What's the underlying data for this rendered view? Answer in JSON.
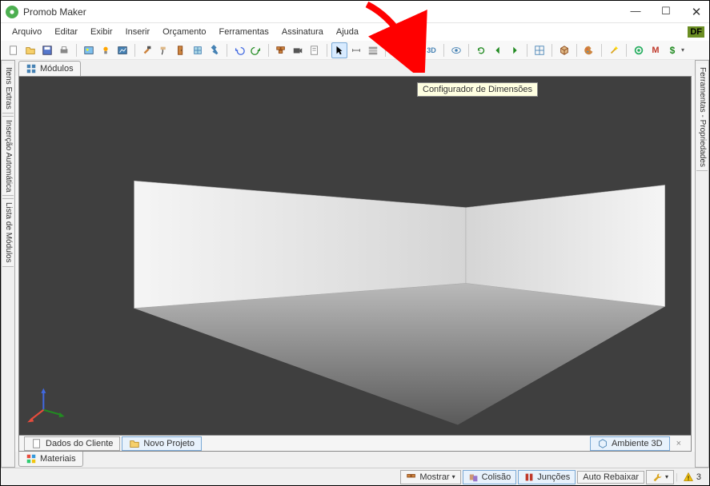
{
  "window": {
    "title": "Promob Maker"
  },
  "menus": [
    "Arquivo",
    "Editar",
    "Exibir",
    "Inserir",
    "Orçamento",
    "Ferramentas",
    "Assinatura",
    "Ajuda"
  ],
  "user_badge": "DF",
  "tooltip": "Configurador de Dimensões",
  "leftside": {
    "tab1": "Itens Extras",
    "tab2": "Inserção Automática",
    "tab3": "Lista de Módulos"
  },
  "rightside": {
    "tab1": "Ferramentas - Propriedades"
  },
  "top_tab": "Módulos",
  "bottom_tabs": {
    "dados": "Dados do Cliente",
    "novo": "Novo Projeto",
    "ambiente": "Ambiente 3D"
  },
  "bottom_tab2": "Materiais",
  "status": {
    "mostrar": "Mostrar",
    "colisao": "Colisão",
    "juncoes": "Junções",
    "auto": "Auto Rebaixar",
    "warn_count": "3"
  }
}
